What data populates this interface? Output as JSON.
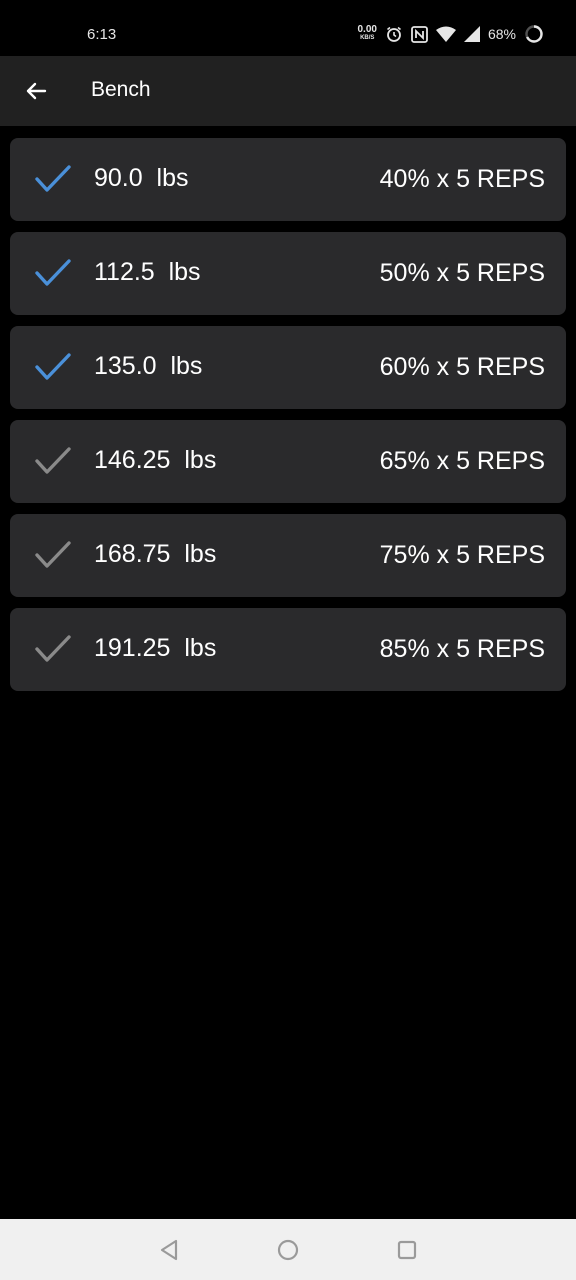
{
  "status_bar": {
    "time": "6:13",
    "net_speed_value": "0.00",
    "net_speed_unit": "KB/S",
    "battery": "68%",
    "icons": [
      "alarm-icon",
      "nfc-icon",
      "wifi-icon",
      "signal-icon",
      "battery-ring-icon"
    ]
  },
  "app_bar": {
    "title": "Bench",
    "back_icon": "arrow-left-icon"
  },
  "colors": {
    "completed_check": "#4a90d9",
    "pending_check": "#8a8a8a",
    "row_background": "#2a2a2c",
    "app_bar_background": "#212121"
  },
  "sets": [
    {
      "weight": "90.0  lbs",
      "scheme": "40% x 5 REPS",
      "completed": true
    },
    {
      "weight": "112.5  lbs",
      "scheme": "50% x 5 REPS",
      "completed": true
    },
    {
      "weight": "135.0  lbs",
      "scheme": "60% x 5 REPS",
      "completed": true
    },
    {
      "weight": "146.25  lbs",
      "scheme": "65% x 5 REPS",
      "completed": false
    },
    {
      "weight": "168.75  lbs",
      "scheme": "75% x 5 REPS",
      "completed": false
    },
    {
      "weight": "191.25  lbs",
      "scheme": "85% x 5 REPS",
      "completed": false
    }
  ],
  "nav_bar": {
    "buttons": [
      "back-triangle-icon",
      "home-circle-icon",
      "recents-square-icon"
    ]
  }
}
